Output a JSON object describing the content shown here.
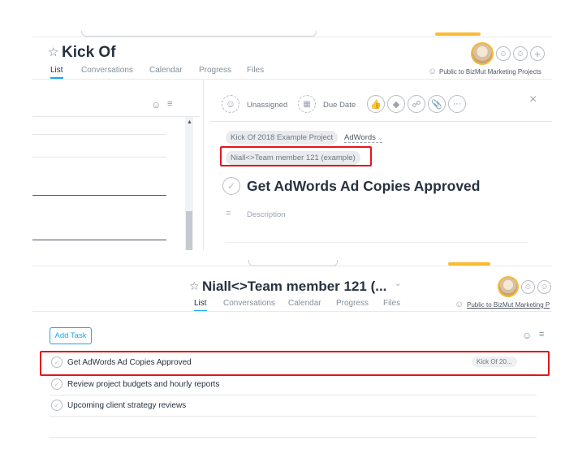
{
  "top": {
    "project_title": "Kick Of",
    "tabs": [
      "List",
      "Conversations",
      "Calendar",
      "Progress",
      "Files"
    ],
    "public_label": "Public to BizMut Marketing Projects",
    "task_detail": {
      "assignee_label": "Unassigned",
      "due_label": "Due Date",
      "project_tag": "Kick Of 2018 Example Project",
      "section_tag": "AdWords",
      "subproject_tag": "Niall<>Team member 121 (example)",
      "task_title": "Get AdWords Ad Copies Approved",
      "description_placeholder": "Description",
      "close_glyph": "×"
    }
  },
  "bottom": {
    "project_title": "Niall<>Team member 121 (...",
    "tabs": [
      "List",
      "Conversations",
      "Calendar",
      "Progress",
      "Files"
    ],
    "public_label": "Public to BizMut Marketing P",
    "add_task_label": "Add Task",
    "tasks": [
      {
        "name": "Get AdWords Ad Copies Approved",
        "tag": "Kick Of 20..."
      },
      {
        "name": "Review project budgets and hourly reports",
        "tag": ""
      },
      {
        "name": "Upcoming client strategy reviews",
        "tag": ""
      }
    ]
  },
  "colors": {
    "highlight": "#e3161c",
    "accent": "#14aaf5",
    "avatar_ring": "#f6b93b"
  }
}
